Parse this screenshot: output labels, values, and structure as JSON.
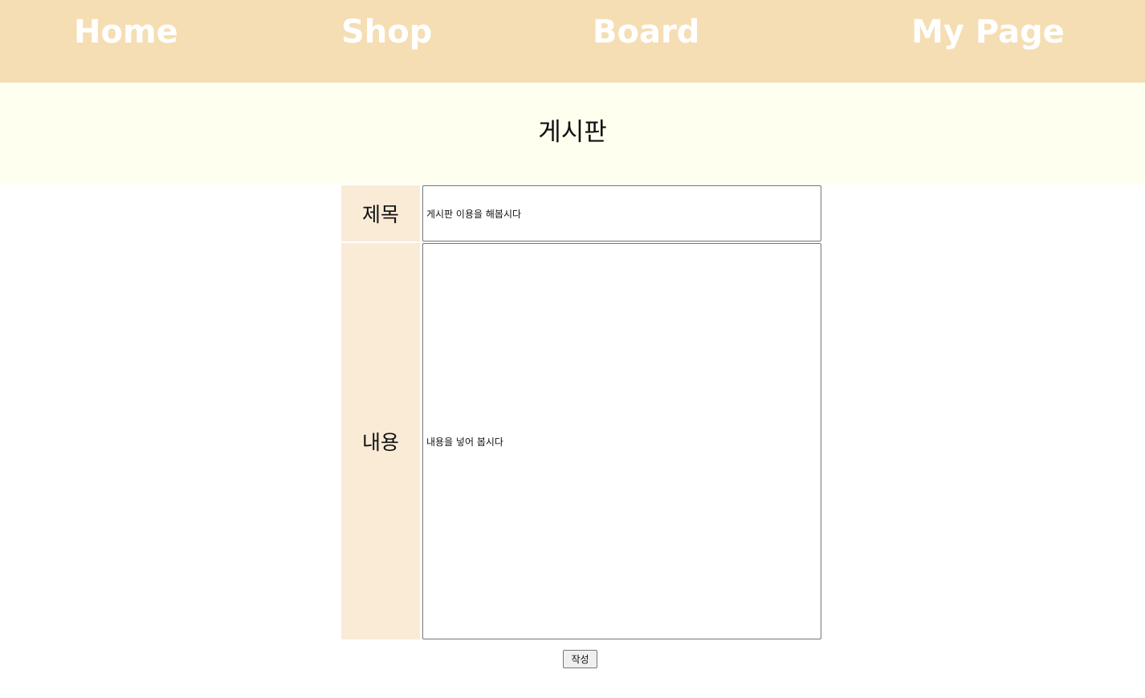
{
  "nav": {
    "items": [
      {
        "label": "Home"
      },
      {
        "label": "Shop"
      },
      {
        "label": "Board"
      },
      {
        "label": "My Page"
      }
    ]
  },
  "banner": {
    "title": "게시판"
  },
  "form": {
    "title_label": "제목",
    "title_value": "게시판 이용을 해봅시다",
    "content_label": "내용",
    "content_value": "내용을 넣어 봅시다",
    "submit_label": "작성"
  },
  "colors": {
    "nav_bg": "#f5deb3",
    "banner_bg": "#fffff0",
    "label_bg": "#faebd7"
  }
}
